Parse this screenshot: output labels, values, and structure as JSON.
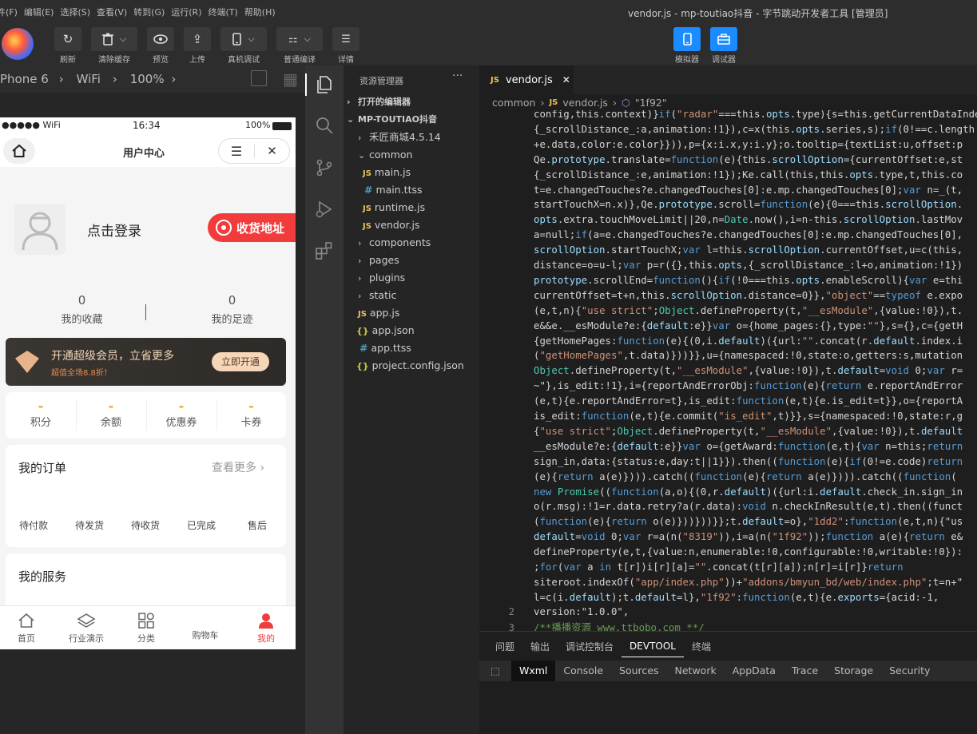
{
  "menu": [
    "件(F)",
    "编辑(E)",
    "选择(S)",
    "查看(V)",
    "转到(G)",
    "运行(R)",
    "终端(T)",
    "帮助(H)"
  ],
  "window_title": "vendor.js - mp-toutiao抖音 - 字节跳动开发者工具 [管理员]",
  "toolbar": {
    "refresh": "刷新",
    "clear_cache": "清除缓存",
    "preview": "预览",
    "upload": "上传",
    "device_debug": "真机调试",
    "compile_mode": "普通编译",
    "details": "详情",
    "simulator": "模拟器",
    "debugger": "调试器"
  },
  "simbar": {
    "device": "Phone 6",
    "network": "WiFi",
    "zoom": "100%"
  },
  "phone": {
    "status": {
      "carrier": "●●●●● WiFi",
      "time": "16:34",
      "battery": "100%"
    },
    "nav_title": "用户中心",
    "login": "点击登录",
    "address_btn": "收货地址",
    "stats": [
      {
        "value": "0",
        "label": "我的收藏"
      },
      {
        "value": "0",
        "label": "我的足迹"
      }
    ],
    "vip": {
      "title": "开通超级会员，立省更多",
      "subtitle": "超值全场8.8折！",
      "button": "立即开通"
    },
    "assets": [
      {
        "value": "-",
        "label": "积分"
      },
      {
        "value": "-",
        "label": "余额"
      },
      {
        "value": "-",
        "label": "优惠券"
      },
      {
        "value": "-",
        "label": "卡券"
      }
    ],
    "orders": {
      "title": "我的订单",
      "more": "查看更多",
      "items": [
        "待付款",
        "待发货",
        "待收货",
        "已完成",
        "售后"
      ]
    },
    "services_title": "我的服务",
    "tabbar": [
      {
        "label": "首页"
      },
      {
        "label": "行业演示"
      },
      {
        "label": "分类"
      },
      {
        "label": "购物车"
      },
      {
        "label": "我的"
      }
    ]
  },
  "explorer": {
    "title": "资源管理器",
    "open_editors": "打开的编辑器",
    "project": "MP-TOUTIAO抖音",
    "items": [
      {
        "label": "禾匠商城4.5.14",
        "type": "folder"
      },
      {
        "label": "common",
        "type": "folder-open"
      },
      {
        "label": "main.js",
        "type": "js"
      },
      {
        "label": "main.ttss",
        "type": "css"
      },
      {
        "label": "runtime.js",
        "type": "js"
      },
      {
        "label": "vendor.js",
        "type": "js"
      },
      {
        "label": "components",
        "type": "folder"
      },
      {
        "label": "pages",
        "type": "folder"
      },
      {
        "label": "plugins",
        "type": "folder"
      },
      {
        "label": "static",
        "type": "folder"
      },
      {
        "label": "app.js",
        "type": "js"
      },
      {
        "label": "app.json",
        "type": "json"
      },
      {
        "label": "app.ttss",
        "type": "css"
      },
      {
        "label": "project.config.json",
        "type": "json"
      }
    ]
  },
  "editor": {
    "tab": "vendor.js",
    "breadcrumb": [
      "common",
      "vendor.js",
      "\"1f92\""
    ],
    "line_numbers": [
      "2",
      "3"
    ],
    "lines": [
      "config,this.context)}if(\"radar\"===this.opts.type){s=this.getCurrentDataIndex",
      "{_scrollDistance_:a,animation:!1}),c=x(this.opts.series,s);if(0!==c.length",
      "+e.data,color:e.color}})),p={x:i.x,y:i.y};o.tooltip={textList:u,offset:p",
      "Qe.prototype.translate=function(e){this.scrollOption={currentOffset:e,st",
      "{_scrollDistance_:e,animation:!1});Ke.call(this,this.opts.type,t,this.co",
      "t=e.changedTouches?e.changedTouches[0]:e.mp.changedTouches[0];var n=_(t,",
      "startTouchX=n.x)},Qe.prototype.scroll=function(e){0===this.scrollOption.",
      "opts.extra.touchMoveLimit||20,n=Date.now(),i=n-this.scrollOption.lastMov",
      "a=null;if(a=e.changedTouches?e.changedTouches[0]:e.mp.changedTouches[0],",
      "scrollOption.startTouchX;var l=this.scrollOption.currentOffset,u=c(this,",
      "distance=o=u-l;var p=r({},this.opts,{_scrollDistance_:l+o,animation:!1})",
      "prototype.scrollEnd=function(){if(!0===this.opts.enableScroll){var e=thi",
      "currentOffset=t+n,this.scrollOption.distance=0}},\"object\"==typeof e.expo",
      "(e,t,n){\"use strict\";Object.defineProperty(t,\"__esModule\",{value:!0}),t.",
      "e&&e.__esModule?e:{default:e}}var o={home_pages:{},type:\"\"},s={},c={getH",
      "{getHomePages:function(e){(0,i.default)({url:\"\".concat(r.default.index.i",
      "(\"getHomePages\",t.data)}))}},u={namespaced:!0,state:o,getters:s,mutation",
      "Object.defineProperty(t,\"__esModule\",{value:!0}),t.default=void 0;var r=",
      "~\"},is_edit:!1},i={reportAndErrorObj:function(e){return e.reportAndError",
      "(e,t){e.reportAndError=t},is_edit:function(e,t){e.is_edit=t}},o={reportA",
      "is_edit:function(e,t){e.commit(\"is_edit\",t)}},s={namespaced:!0,state:r,g",
      "{\"use strict\";Object.defineProperty(t,\"__esModule\",{value:!0}),t.default",
      "__esModule?e:{default:e}}var o={getAward:function(e,t){var n=this;return",
      "sign_in,data:{status:e,day:t||1}}).then((function(e){if(0!=e.code)return",
      "(e){return a(e)}))).catch((function(e){return a(e)}))).catch((function(",
      "new Promise((function(a,o){(0,r.default)({url:i.default.check_in.sign_in",
      "o(r.msg):!1=r.data.retry?a(r.data):void n.checkInResult(e,t).then((funct",
      "(function(e){return o(e)}))}))}};t.default=o},\"1dd2\":function(e,t,n){\"us",
      "default=void 0;var r=a(n(\"8319\")),i=a(n(\"1f92\"));function a(e){return e&",
      "defineProperty(e,t,{value:n,enumerable:!0,configurable:!0,writable:!0}):",
      ";for(var a in t[r])i[r][a]=\"\".concat(t[r][a]);n[r]=i[r]}return",
      "siteroot.indexOf(\"app/index.php\"))+\"addons/bmyun_bd/web/index.php\";t=n+\"",
      "l=c(i.default);t.default=l},\"1f92\":function(e,t){e.exports={acid:-1,"
    ],
    "line2": "    version:\"1.0.0\",",
    "line3": "/**播播资源 www.ttbobo.com **/"
  },
  "panel": {
    "tabs": [
      "问题",
      "输出",
      "调试控制台",
      "DEVTOOL",
      "终端"
    ],
    "devtools": [
      "Wxml",
      "Console",
      "Sources",
      "Network",
      "AppData",
      "Trace",
      "Storage",
      "Security"
    ]
  }
}
